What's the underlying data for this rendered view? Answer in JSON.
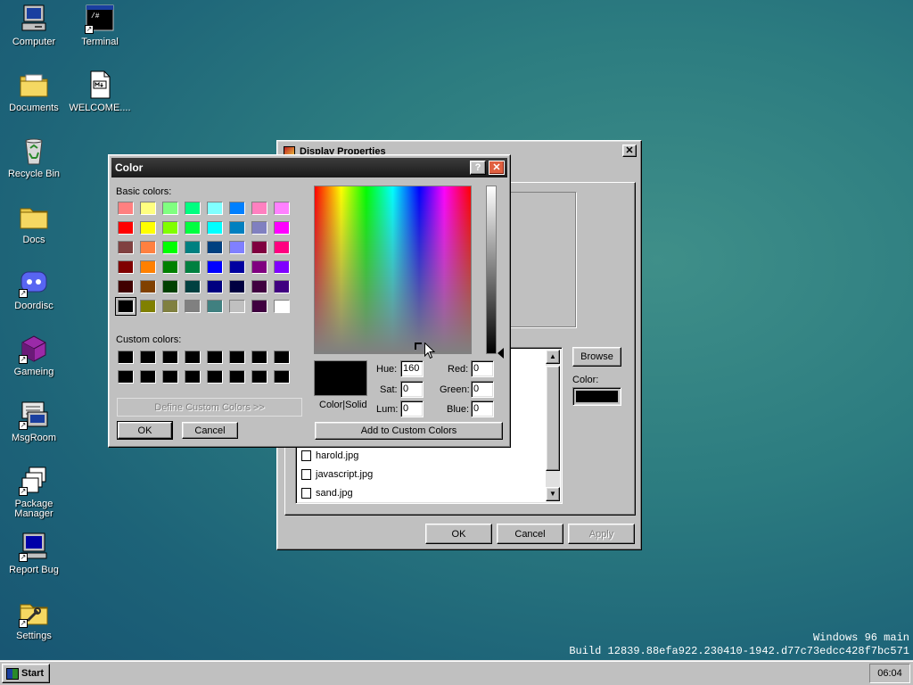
{
  "desktop": {
    "icons": [
      {
        "label": "Computer",
        "icon": "computer-icon"
      },
      {
        "label": "Terminal",
        "icon": "terminal-icon"
      },
      {
        "label": "Documents",
        "icon": "folder-documents-icon"
      },
      {
        "label": "WELCOME....",
        "icon": "markdown-file-icon"
      },
      {
        "label": "Recycle Bin",
        "icon": "recycle-bin-icon"
      },
      {
        "label": "Docs",
        "icon": "folder-icon"
      },
      {
        "label": "Doordisc",
        "icon": "discord-icon"
      },
      {
        "label": "Gameing",
        "icon": "game-cube-icon"
      },
      {
        "label": "MsgRoom",
        "icon": "chat-icon"
      },
      {
        "label": "Package Manager",
        "icon": "package-icon"
      },
      {
        "label": "Report Bug",
        "icon": "bug-report-icon"
      },
      {
        "label": "Settings",
        "icon": "settings-icon"
      }
    ],
    "terminal_glyph": "/#"
  },
  "display_properties": {
    "title": "Display Properties",
    "close_glyph": "✕",
    "browse_label": "Browse",
    "color_label": "Color:",
    "files": [
      "harold.jpg",
      "javascript.jpg",
      "sand.jpg"
    ],
    "ok_label": "OK",
    "cancel_label": "Cancel",
    "apply_label": "Apply"
  },
  "color_dialog": {
    "title": "Color",
    "help_glyph": "?",
    "close_glyph": "✕",
    "basic_colors_label": "Basic colors:",
    "custom_colors_label": "Custom colors:",
    "define_custom_label": "Define Custom Colors >>",
    "ok_label": "OK",
    "cancel_label": "Cancel",
    "add_custom_label": "Add to Custom Colors",
    "color_solid_label": "Color|Solid",
    "hue_label": "Hue:",
    "hue_value": "160",
    "sat_label": "Sat:",
    "sat_value": "0",
    "lum_label": "Lum:",
    "lum_value": "0",
    "red_label": "Red:",
    "red_value": "0",
    "green_label": "Green:",
    "green_value": "0",
    "blue_label": "Blue:",
    "blue_value": "0",
    "basic_colors": [
      "#ff8080",
      "#ffff80",
      "#80ff80",
      "#00ff80",
      "#80ffff",
      "#0080ff",
      "#ff80c0",
      "#ff80ff",
      "#ff0000",
      "#ffff00",
      "#80ff00",
      "#00ff40",
      "#00ffff",
      "#0080c0",
      "#8080c0",
      "#ff00ff",
      "#804040",
      "#ff8040",
      "#00ff00",
      "#008080",
      "#004080",
      "#8080ff",
      "#800040",
      "#ff0080",
      "#800000",
      "#ff8000",
      "#008000",
      "#008040",
      "#0000ff",
      "#0000a0",
      "#800080",
      "#8000ff",
      "#400000",
      "#804000",
      "#004000",
      "#004040",
      "#000080",
      "#000040",
      "#400040",
      "#400080",
      "#000000",
      "#808000",
      "#808040",
      "#808080",
      "#408080",
      "#c0c0c0",
      "#400040",
      "#ffffff"
    ],
    "custom_colors": [
      "#000000",
      "#000000",
      "#000000",
      "#000000",
      "#000000",
      "#000000",
      "#000000",
      "#000000",
      "#000000",
      "#000000",
      "#000000",
      "#000000",
      "#000000",
      "#000000",
      "#000000",
      "#000000"
    ],
    "selected_color": "#000000"
  },
  "taskbar": {
    "start_label": "Start",
    "clock": "06:04"
  },
  "build_info": {
    "line1": "Windows 96 main",
    "line2": "Build 12839.88efa922.230410-1942.d77c73edcc428f7bc571"
  }
}
